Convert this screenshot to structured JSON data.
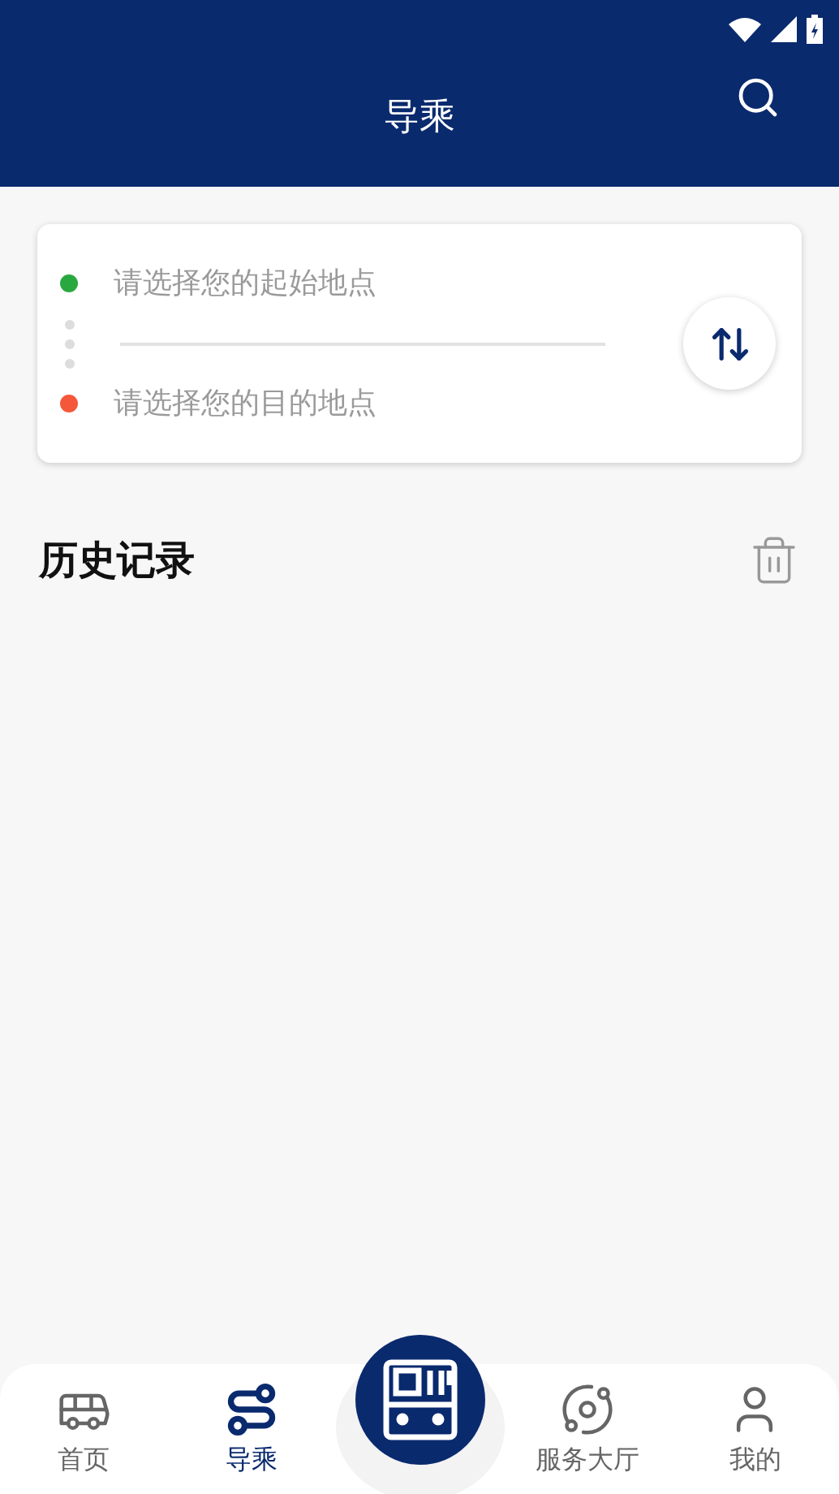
{
  "header": {
    "title": "导乘"
  },
  "route": {
    "stops": [
      {
        "placeholder": "请选择您的起始地点",
        "color": "#2aa840"
      },
      {
        "placeholder": "请选择您的目的地点",
        "color": "#f4573a"
      }
    ]
  },
  "history": {
    "title": "历史记录"
  },
  "tabbar": [
    {
      "kind": "tab",
      "label": "首页",
      "selected": false
    },
    {
      "kind": "tab",
      "label": "导乘",
      "selected": true
    },
    {
      "kind": "scan",
      "selected": false
    },
    {
      "kind": "tab",
      "label": "服务大厅",
      "selected": false
    },
    {
      "kind": "tab",
      "label": "我的",
      "selected": false
    }
  ]
}
